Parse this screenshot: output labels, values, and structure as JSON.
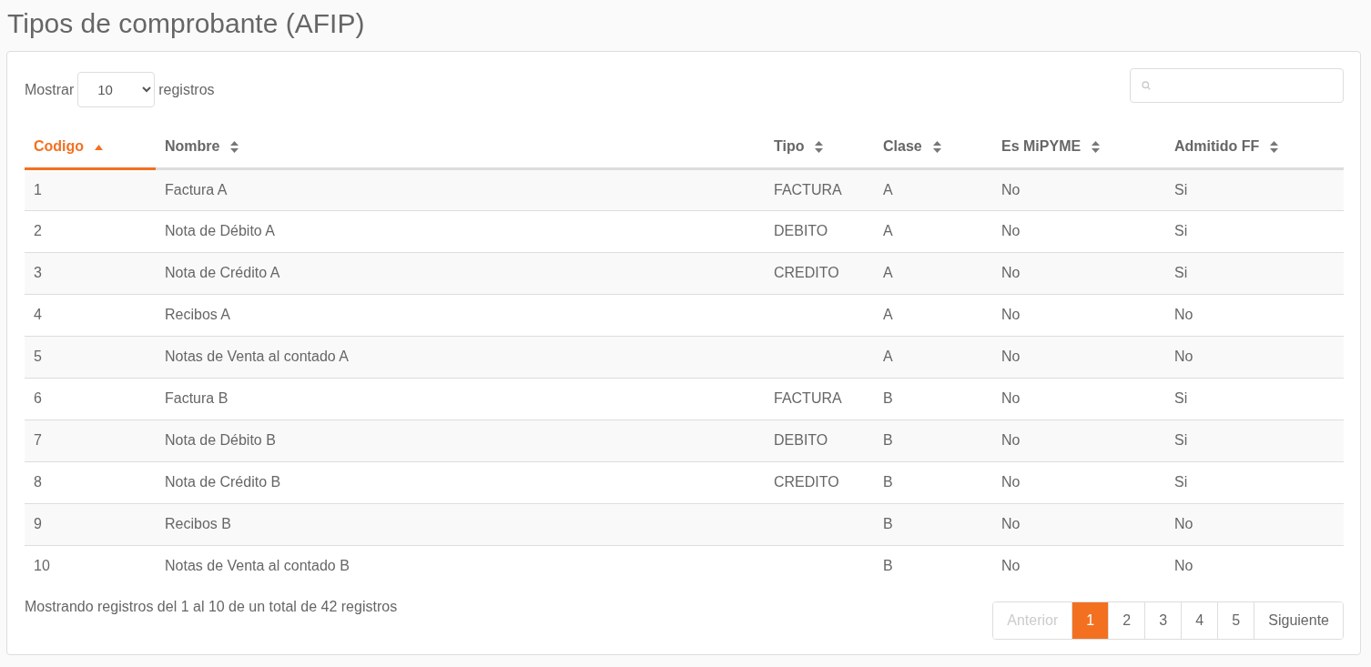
{
  "page_title": "Tipos de comprobante (AFIP)",
  "length_control": {
    "prefix": "Mostrar",
    "value": "10",
    "suffix": "registros"
  },
  "table": {
    "columns": [
      {
        "label": "Codigo",
        "selected": true
      },
      {
        "label": "Nombre",
        "selected": false
      },
      {
        "label": "Tipo",
        "selected": false
      },
      {
        "label": "Clase",
        "selected": false
      },
      {
        "label": "Es MiPYME",
        "selected": false
      },
      {
        "label": "Admitido FF",
        "selected": false
      }
    ],
    "rows": [
      [
        "1",
        "Factura A",
        "FACTURA",
        "A",
        "No",
        "Si"
      ],
      [
        "2",
        "Nota de Débito A",
        "DEBITO",
        "A",
        "No",
        "Si"
      ],
      [
        "3",
        "Nota de Crédito A",
        "CREDITO",
        "A",
        "No",
        "Si"
      ],
      [
        "4",
        "Recibos A",
        "",
        "A",
        "No",
        "No"
      ],
      [
        "5",
        "Notas de Venta al contado A",
        "",
        "A",
        "No",
        "No"
      ],
      [
        "6",
        "Factura B",
        "FACTURA",
        "B",
        "No",
        "Si"
      ],
      [
        "7",
        "Nota de Débito B",
        "DEBITO",
        "B",
        "No",
        "Si"
      ],
      [
        "8",
        "Nota de Crédito B",
        "CREDITO",
        "B",
        "No",
        "Si"
      ],
      [
        "9",
        "Recibos B",
        "",
        "B",
        "No",
        "No"
      ],
      [
        "10",
        "Notas de Venta al contado B",
        "",
        "B",
        "No",
        "No"
      ]
    ]
  },
  "info": "Mostrando registros del 1 al 10 de un total de 42 registros",
  "pagination": [
    {
      "label": "Anterior",
      "selected": false,
      "disabled": true
    },
    {
      "label": "1",
      "selected": true,
      "disabled": false
    },
    {
      "label": "2",
      "selected": false,
      "disabled": false
    },
    {
      "label": "3",
      "selected": false,
      "disabled": false
    },
    {
      "label": "4",
      "selected": false,
      "disabled": false
    },
    {
      "label": "5",
      "selected": false,
      "disabled": false
    },
    {
      "label": "Siguiente",
      "selected": false,
      "disabled": false
    }
  ]
}
